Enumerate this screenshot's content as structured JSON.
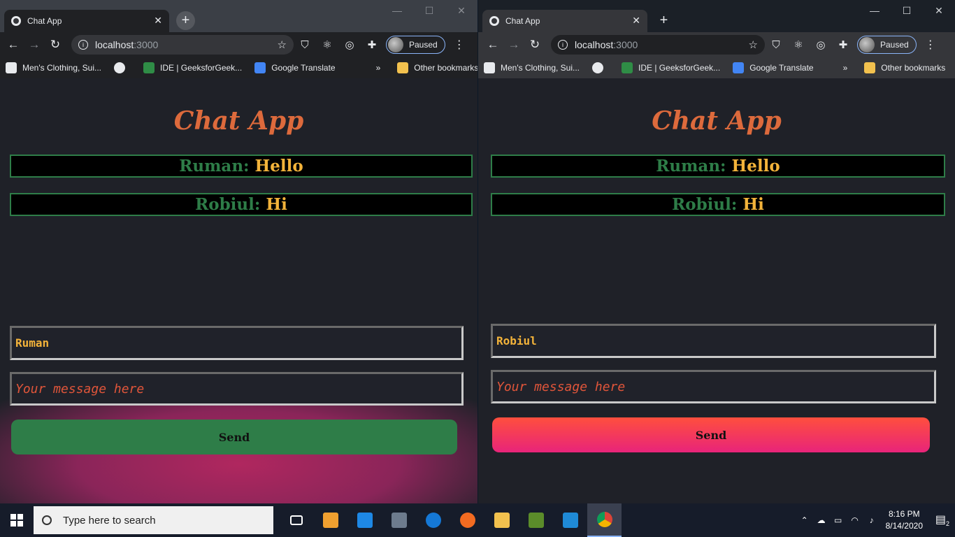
{
  "colors": {
    "title": "#dd6a3c",
    "sender": "#2e7d48",
    "message": "#f3b33a",
    "input_text": "#f3b33a",
    "placeholder": "#e0553a",
    "left_send": "#2e7d48",
    "right_send_gradient": [
      "#ff4f3d",
      "#e8247a"
    ]
  },
  "windows": [
    {
      "tab_title": "Chat App",
      "url_host": "localhost",
      "url_port": ":3000",
      "profile_label": "Paused",
      "bookmarks": [
        "Men's Clothing, Sui...",
        "IDE | GeeksforGeek...",
        "Google Translate"
      ],
      "other_bookmarks": "Other bookmarks",
      "app_title": "Chat App",
      "messages": [
        {
          "sender": "Ruman:",
          "text": "Hello"
        },
        {
          "sender": "Robiul:",
          "text": "Hi"
        }
      ],
      "name_value": "Ruman",
      "message_placeholder": "Your message here",
      "send_label": "Send"
    },
    {
      "tab_title": "Chat App",
      "url_host": "localhost",
      "url_port": ":3000",
      "profile_label": "Paused",
      "bookmarks": [
        "Men's Clothing, Sui...",
        "IDE | GeeksforGeek...",
        "Google Translate"
      ],
      "other_bookmarks": "Other bookmarks",
      "app_title": "Chat App",
      "messages": [
        {
          "sender": "Ruman:",
          "text": "Hello"
        },
        {
          "sender": "Robiul:",
          "text": "Hi"
        }
      ],
      "name_value": "Robiul",
      "message_placeholder": "Your message here",
      "send_label": "Send"
    }
  ],
  "taskbar": {
    "search_placeholder": "Type here to search",
    "time": "8:16 PM",
    "date": "8/14/2020",
    "notification_count": "2",
    "apps": [
      "task-view",
      "microsoft-store",
      "mail",
      "calculator",
      "edge",
      "firefox",
      "file-explorer",
      "app",
      "vscode",
      "chrome"
    ]
  }
}
